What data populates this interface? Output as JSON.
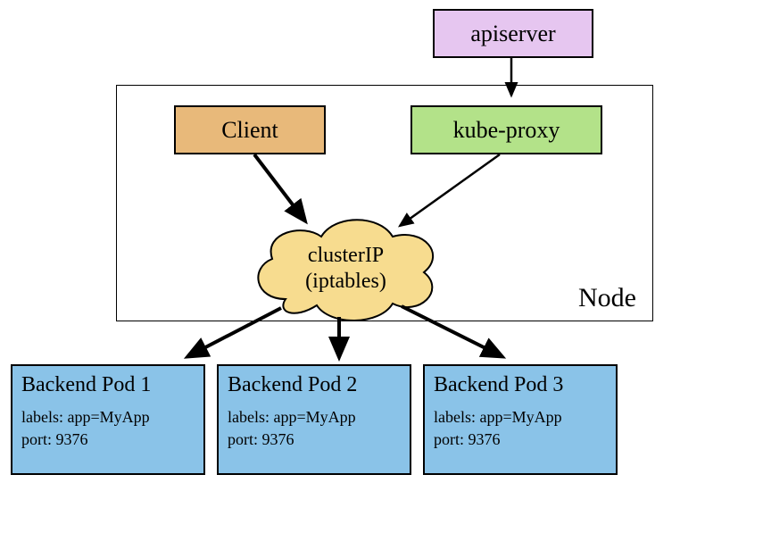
{
  "apiserver": {
    "label": "apiserver"
  },
  "node": {
    "label": "Node"
  },
  "client": {
    "label": "Client"
  },
  "kubeproxy": {
    "label": "kube-proxy"
  },
  "clusterip": {
    "line1": "clusterIP",
    "line2": "(iptables)"
  },
  "pods": [
    {
      "title": "Backend Pod 1",
      "labels": "labels: app=MyApp",
      "port": "port: 9376"
    },
    {
      "title": "Backend Pod 2",
      "labels": "labels: app=MyApp",
      "port": "port: 9376"
    },
    {
      "title": "Backend Pod 3",
      "labels": "labels: app=MyApp",
      "port": "port: 9376"
    }
  ],
  "colors": {
    "apiserver": "#e6c6f0",
    "client": "#e8b97a",
    "kubeproxy": "#b3e289",
    "clusterip": "#f7dc8f",
    "pod": "#8ac3e8"
  }
}
